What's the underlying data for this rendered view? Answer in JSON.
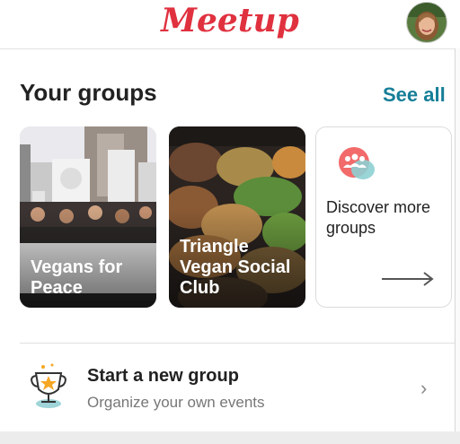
{
  "header": {
    "logo_text": "Meetup",
    "avatar": "profile-avatar"
  },
  "groups_section": {
    "title": "Your groups",
    "see_all_label": "See all"
  },
  "groups": [
    {
      "name": "Vegans for Peace"
    },
    {
      "name": "Triangle Vegan Social Club"
    }
  ],
  "discover": {
    "label": "Discover more groups",
    "icon": "people-group-icon",
    "arrow": "→"
  },
  "new_group": {
    "title": "Start a new group",
    "subtitle": "Organize your own events",
    "chevron": "›"
  },
  "colors": {
    "brand": "#e0313f",
    "link": "#167e98"
  }
}
